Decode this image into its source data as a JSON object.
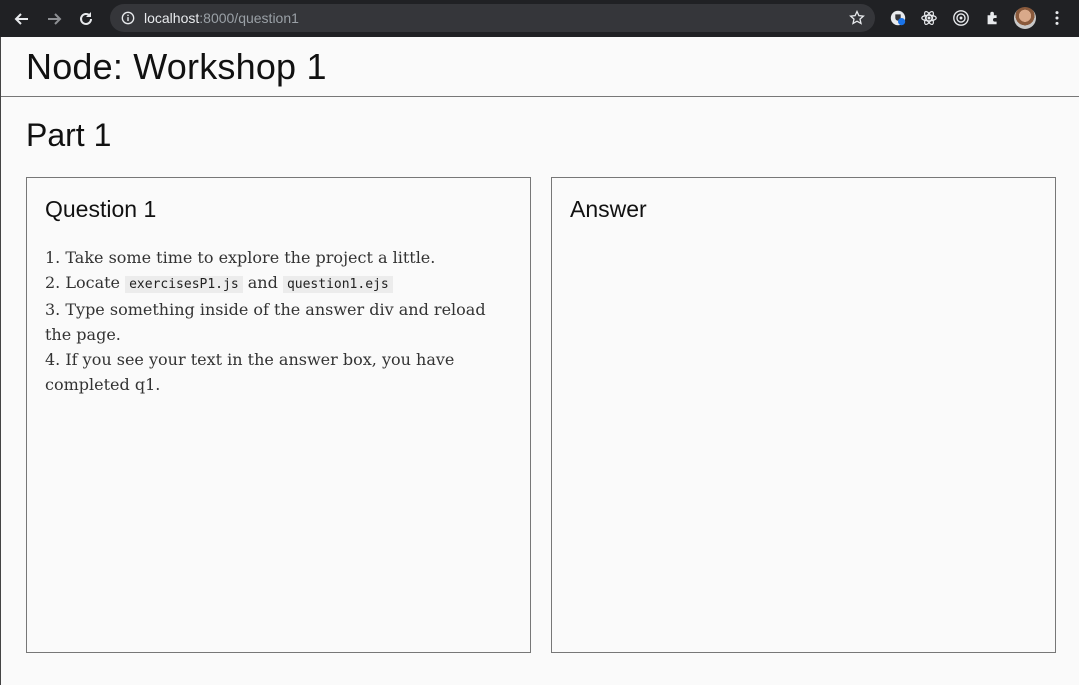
{
  "browser": {
    "url_host": "localhost",
    "url_rest": ":8000/question1"
  },
  "header": {
    "title": "Node: Workshop 1"
  },
  "main": {
    "part_title": "Part 1",
    "question": {
      "title": "Question 1",
      "step1": "1. Take some time to explore the project a little.",
      "step2_prefix": "2. Locate ",
      "step2_file1": "exercisesP1.js",
      "step2_and": " and ",
      "step2_file2": "question1.ejs",
      "step3": "3. Type something inside of the answer div and reload the page.",
      "step4": "4. If you see your text in the answer box, you have completed q1."
    },
    "answer": {
      "title": "Answer"
    }
  }
}
